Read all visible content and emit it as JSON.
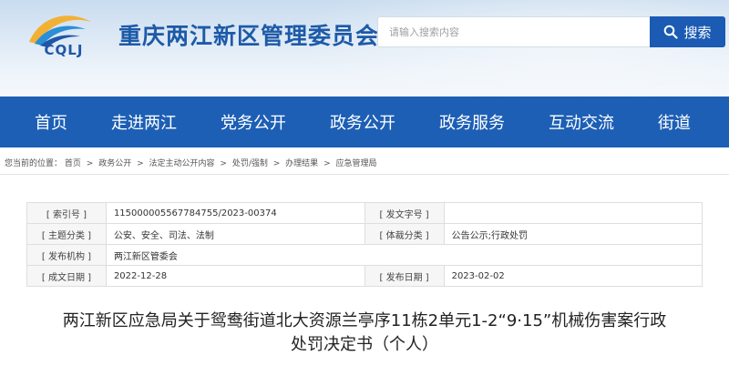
{
  "header": {
    "logo_text": "CQLJ",
    "site_title": "重庆两江新区管理委员会",
    "search_placeholder": "请输入搜索内容",
    "search_button": "搜索",
    "search_icon": "search-icon"
  },
  "nav": {
    "items": [
      {
        "label": "首页"
      },
      {
        "label": "走进两江"
      },
      {
        "label": "党务公开"
      },
      {
        "label": "政务公开"
      },
      {
        "label": "政务服务"
      },
      {
        "label": "互动交流"
      },
      {
        "label": "街道"
      }
    ]
  },
  "breadcrumb": {
    "prefix": "您当前的位置：",
    "items": [
      "首页",
      "政务公开",
      "法定主动公开内容",
      "处罚/强制",
      "办理结果",
      "应急管理局"
    ],
    "separator": ">"
  },
  "meta": {
    "index_label": "[ 索引号 ]",
    "index_value": "115000005567784755/2023-00374",
    "doc_no_label": "[ 发文字号 ]",
    "doc_no_value": "",
    "subject_label": "[ 主题分类 ]",
    "subject_value": "公安、安全、司法、法制",
    "genre_label": "[ 体裁分类 ]",
    "genre_value": "公告公示;行政处罚",
    "issuer_label": "[ 发布机构 ]",
    "issuer_value": "两江新区管委会",
    "created_label": "[ 成文日期 ]",
    "created_value": "2022-12-28",
    "published_label": "[ 发布日期 ]",
    "published_value": "2023-02-02"
  },
  "article": {
    "title_line1": "两江新区应急局关于鸳鸯街道北大资源兰亭序11栋2单元1-2“9·15”机械伤害案行政",
    "title_line2": "处罚决定书（个人）"
  },
  "colors": {
    "brand_blue": "#1d5fb5",
    "title_blue": "#1d5aa8",
    "search_button": "#1b5bb3"
  }
}
